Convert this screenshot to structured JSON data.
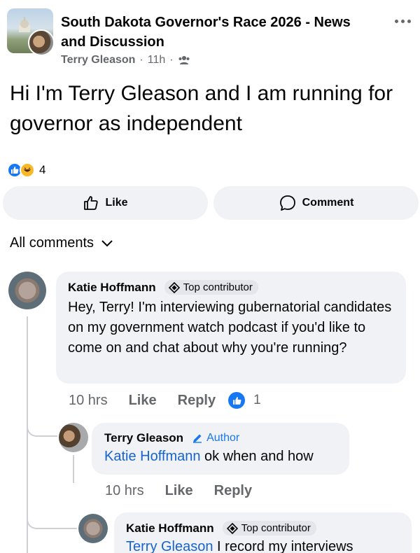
{
  "post": {
    "group_title": "South Dakota Governor's Race 2026 - News and Discussion",
    "author": "Terry Gleason",
    "separator": "·",
    "time": "11h",
    "privacy_icon": "members-icon",
    "text": "Hi I'm Terry Gleason and I am running for governor as independent",
    "reaction_count": "4",
    "reaction_icons": [
      "like-reaction-icon",
      "haha-reaction-icon"
    ]
  },
  "actions": {
    "like_label": "Like",
    "comment_label": "Comment"
  },
  "comments_filter": {
    "label": "All comments"
  },
  "comments": [
    {
      "author": "Katie Hoffmann",
      "badge": "Top contributor",
      "text": "Hey, Terry! I'm interviewing gubernatorial candidates on my government watch podcast if you'd like to come on and chat about why you're running?",
      "time": "10 hrs",
      "like_label": "Like",
      "reply_label": "Reply",
      "like_count": "1"
    },
    {
      "author": "Terry Gleason",
      "badge": "Author",
      "mention": "Katie Hoffmann",
      "text": " ok when and how",
      "time": "10 hrs",
      "like_label": "Like",
      "reply_label": "Reply"
    },
    {
      "author": "Katie Hoffmann",
      "badge": "Top contributor",
      "mention": "Terry Gleason",
      "text": " I record my interviews"
    }
  ],
  "colors": {
    "accent": "#1877f2",
    "bubble": "#f0f2f5",
    "secondary_text": "#65676b",
    "mention": "#1763cf"
  }
}
